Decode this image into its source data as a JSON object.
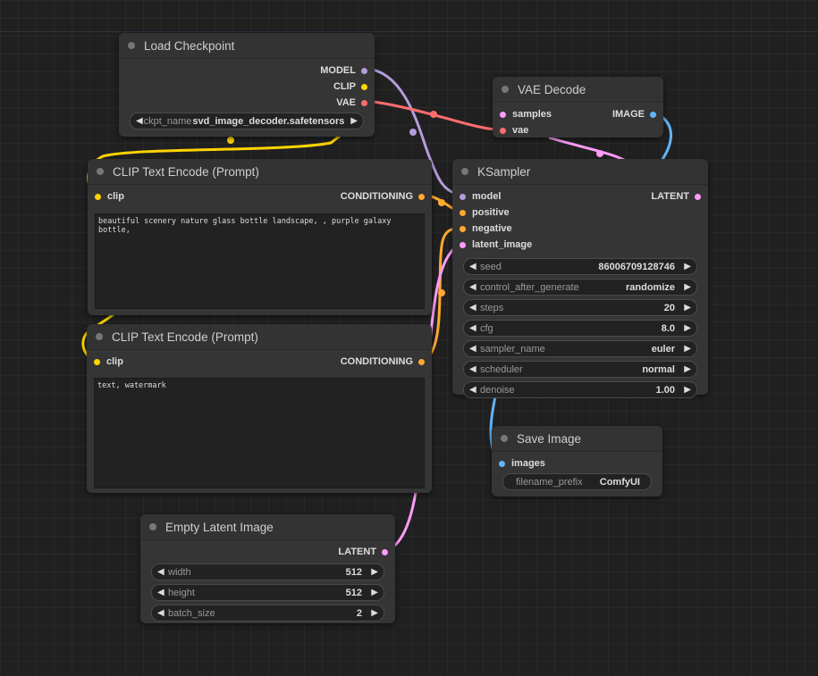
{
  "colors": {
    "model": "#b39ddb",
    "clip": "#ffd500",
    "vae": "#ff6e6e",
    "conditioning": "#ffa931",
    "latent": "#ff9cf9",
    "image": "#64b5f6"
  },
  "nodes": {
    "load_checkpoint": {
      "title": "Load Checkpoint",
      "outputs": [
        "MODEL",
        "CLIP",
        "VAE"
      ],
      "ckpt_label": "ckpt_name",
      "ckpt_value": "svd_image_decoder.safetensors"
    },
    "vae_decode": {
      "title": "VAE Decode",
      "inputs": [
        "samples",
        "vae"
      ],
      "output": "IMAGE"
    },
    "clip_pos": {
      "title": "CLIP Text Encode (Prompt)",
      "input": "clip",
      "output": "CONDITIONING",
      "text": "beautiful scenery nature glass bottle landscape, , purple galaxy bottle,"
    },
    "clip_neg": {
      "title": "CLIP Text Encode (Prompt)",
      "input": "clip",
      "output": "CONDITIONING",
      "text": "text, watermark"
    },
    "ksampler": {
      "title": "KSampler",
      "inputs": [
        "model",
        "positive",
        "negative",
        "latent_image"
      ],
      "output": "LATENT",
      "widgets": [
        {
          "label": "seed",
          "value": "86006709128746"
        },
        {
          "label": "control_after_generate",
          "value": "randomize"
        },
        {
          "label": "steps",
          "value": "20"
        },
        {
          "label": "cfg",
          "value": "8.0"
        },
        {
          "label": "sampler_name",
          "value": "euler"
        },
        {
          "label": "scheduler",
          "value": "normal"
        },
        {
          "label": "denoise",
          "value": "1.00"
        }
      ]
    },
    "save_image": {
      "title": "Save Image",
      "input": "images",
      "prefix_label": "filename_prefix",
      "prefix_value": "ComfyUI"
    },
    "empty_latent": {
      "title": "Empty Latent Image",
      "output": "LATENT",
      "widgets": [
        {
          "label": "width",
          "value": "512"
        },
        {
          "label": "height",
          "value": "512"
        },
        {
          "label": "batch_size",
          "value": "2"
        }
      ]
    }
  }
}
